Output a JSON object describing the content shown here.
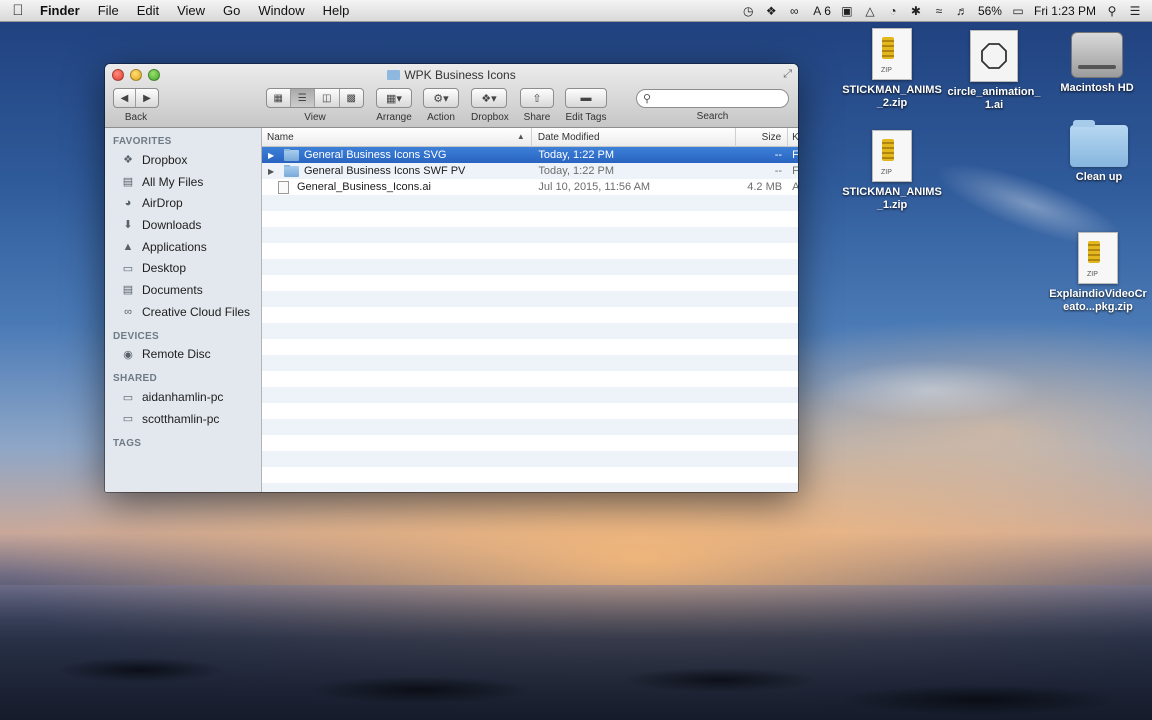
{
  "menubar": {
    "apple": "",
    "app": "Finder",
    "items": [
      "File",
      "Edit",
      "View",
      "Go",
      "Window",
      "Help"
    ],
    "status": {
      "adobe": "6",
      "battery": "56%",
      "clock": "Fri 1:23 PM"
    }
  },
  "window": {
    "title": "WPK Business Icons",
    "toolbar": {
      "back": "Back",
      "view": "View",
      "arrange": "Arrange",
      "action": "Action",
      "dropbox": "Dropbox",
      "share": "Share",
      "edit_tags": "Edit Tags",
      "search": "Search",
      "search_placeholder": ""
    },
    "sidebar": {
      "favorites_header": "FAVORITES",
      "favorites": [
        {
          "label": "Dropbox",
          "icon": "dropbox-icon"
        },
        {
          "label": "All My Files",
          "icon": "all-files-icon"
        },
        {
          "label": "AirDrop",
          "icon": "airdrop-icon"
        },
        {
          "label": "Downloads",
          "icon": "downloads-icon"
        },
        {
          "label": "Applications",
          "icon": "applications-icon"
        },
        {
          "label": "Desktop",
          "icon": "desktop-icon"
        },
        {
          "label": "Documents",
          "icon": "documents-icon"
        },
        {
          "label": "Creative Cloud Files",
          "icon": "creative-cloud-icon"
        }
      ],
      "devices_header": "DEVICES",
      "devices": [
        {
          "label": "Remote Disc",
          "icon": "disc-icon"
        }
      ],
      "shared_header": "SHARED",
      "shared": [
        {
          "label": "aidanhamlin-pc",
          "icon": "pc-icon"
        },
        {
          "label": "scotthamlin-pc",
          "icon": "pc-icon"
        }
      ],
      "tags_header": "TAGS"
    },
    "list": {
      "columns": {
        "name": "Name",
        "date": "Date Modified",
        "size": "Size",
        "kind": "K"
      },
      "rows": [
        {
          "name": "General Business Icons SVG",
          "date": "Today, 1:22 PM",
          "size": "--",
          "kind": "F",
          "type": "folder",
          "selected": true
        },
        {
          "name": "General Business Icons SWF PV",
          "date": "Today, 1:22 PM",
          "size": "--",
          "kind": "F",
          "type": "folder",
          "selected": false
        },
        {
          "name": "General_Business_Icons.ai",
          "date": "Jul 10, 2015, 11:56 AM",
          "size": "4.2 MB",
          "kind": "A",
          "type": "file",
          "selected": false
        }
      ]
    }
  },
  "desktop": {
    "icons": [
      {
        "label": "STICKMAN_ANIMS_2.zip",
        "kind": "zip"
      },
      {
        "label": "circle_animation_1.ai",
        "kind": "ai"
      },
      {
        "label": "Macintosh HD",
        "kind": "hdd"
      },
      {
        "label": "STICKMAN_ANIMS_1.zip",
        "kind": "zip"
      },
      {
        "label": "Clean up",
        "kind": "folder"
      },
      {
        "label": "ExplaindioVideoCreato...pkg.zip",
        "kind": "zip"
      }
    ]
  },
  "colors": {
    "selection": "#2f6bcb",
    "sidebar_bg": "#e3e8ee"
  }
}
